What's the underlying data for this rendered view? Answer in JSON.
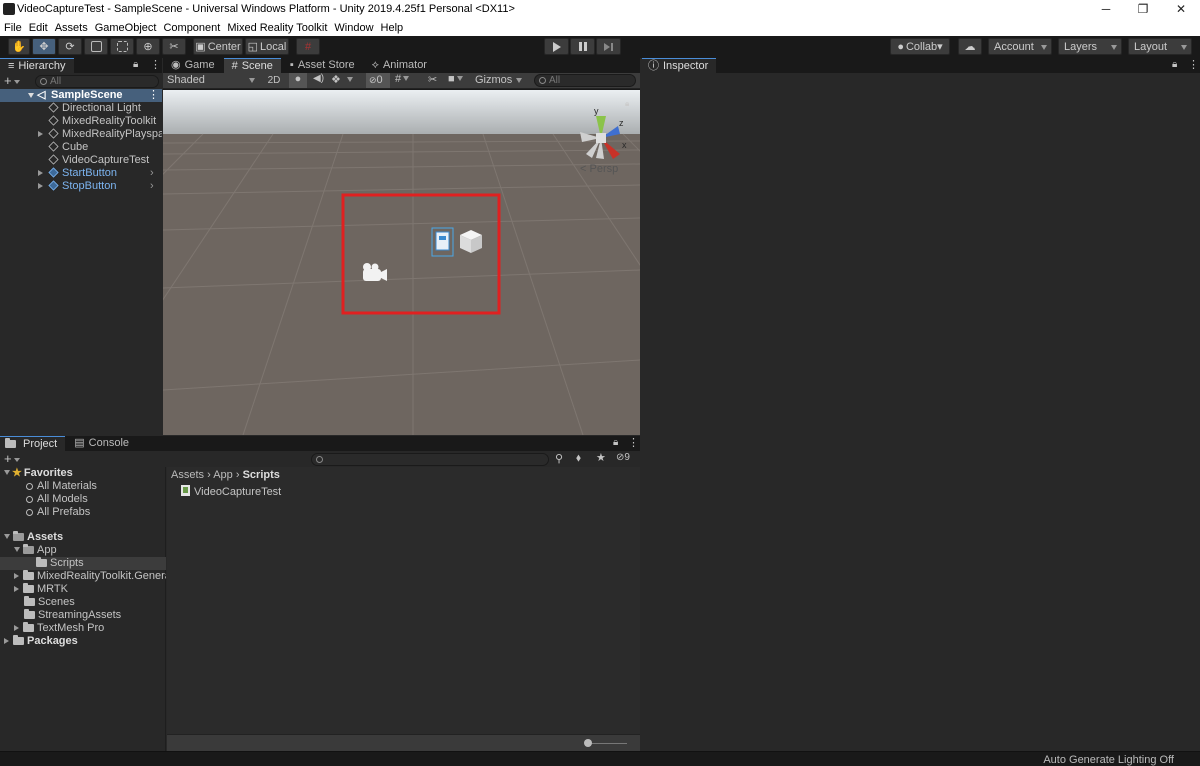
{
  "window": {
    "title": "VideoCaptureTest - SampleScene - Universal Windows Platform - Unity 2019.4.25f1 Personal <DX11>"
  },
  "menu": [
    "File",
    "Edit",
    "Assets",
    "GameObject",
    "Component",
    "Mixed Reality Toolkit",
    "Window",
    "Help"
  ],
  "toolbar": {
    "center_label": "Center",
    "local_label": "Local",
    "collab_label": "Collab▾",
    "account_label": "Account",
    "layers_label": "Layers",
    "layout_label": "Layout"
  },
  "hierarchy": {
    "tab_label": "Hierarchy",
    "search_placeholder": "All",
    "scene_name": "SampleScene",
    "items": [
      {
        "label": "Directional Light"
      },
      {
        "label": "MixedRealityToolkit"
      },
      {
        "label": "MixedRealityPlayspace"
      },
      {
        "label": "Cube"
      },
      {
        "label": "VideoCaptureTest"
      },
      {
        "label": "StartButton"
      },
      {
        "label": "StopButton"
      }
    ]
  },
  "scene": {
    "tabs": [
      "Game",
      "Scene",
      "Asset Store",
      "Animator"
    ],
    "shading_mode": "Shaded",
    "mode_2d": "2D",
    "hidden_count": "0",
    "gizmos_label": "Gizmos",
    "search_placeholder": "All",
    "persp_label": "Persp",
    "axis_y": "y",
    "axis_z": "z",
    "axis_x": "x"
  },
  "inspector": {
    "tab_label": "Inspector"
  },
  "project": {
    "tabs": [
      "Project",
      "Console"
    ],
    "hidden_count": "9",
    "favorites_label": "Favorites",
    "favorites": [
      "All Materials",
      "All Models",
      "All Prefabs"
    ],
    "assets_label": "Assets",
    "app_label": "App",
    "scripts_label": "Scripts",
    "folders": [
      "MixedRealityToolkit.Generated",
      "MRTK",
      "Scenes",
      "StreamingAssets",
      "TextMesh Pro"
    ],
    "packages_label": "Packages",
    "breadcrumb": [
      "Assets",
      "App",
      "Scripts"
    ],
    "files": [
      "VideoCaptureTest"
    ]
  },
  "status": {
    "text": "Auto Generate Lighting Off"
  },
  "colors": {
    "accent": "#4a8dd8",
    "highlight": "#e02020",
    "prefab_blue": "#7cb4f0"
  }
}
